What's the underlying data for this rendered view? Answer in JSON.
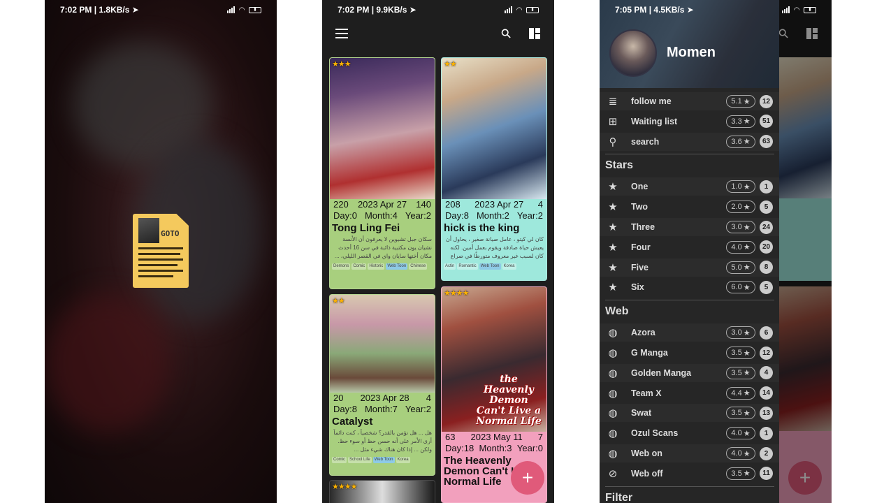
{
  "screens": [
    {
      "status": {
        "time": "7:02 PM",
        "speed": "1.8KB/s"
      },
      "goto_label": "GOTO"
    },
    {
      "status": {
        "time": "7:02 PM",
        "speed": "9.9KB/s"
      },
      "cards": [
        {
          "stars": "★★★",
          "cover_text": "",
          "row1": [
            "220",
            "2023 Apr 27",
            "140"
          ],
          "row2": [
            "Day:0",
            "Month:4",
            "Year:2"
          ],
          "title": "Tong Ling Fei",
          "desc": "سكان جبل تشيوين لا يعرفون أن الأنسة نشيان يون مكتبية ذائبة في سن 16 أحدث مكان أختها سايان واي في القصر الليلي، ...",
          "tags": [
            "Demons",
            "Comic",
            "Historic",
            "Web Toon",
            "Chinese"
          ],
          "color": "#a8cf7e"
        },
        {
          "stars": "★★",
          "cover_text": "",
          "row1": [
            "208",
            "2023 Apr 27",
            "4"
          ],
          "row2": [
            "Day:8",
            "Month:2",
            "Year:2"
          ],
          "title": "hick is the king",
          "desc": "كان لي كيتو ، عامل صيانة صغير ، يحاول أن يعيش حياة صادقة ويقوم بعمل أمين. لكنه كان لسبب غير معروف متورطًا في صراع ...",
          "tags": [
            "Actin",
            "Romantic",
            "Web Toon",
            "Korea"
          ],
          "color": "#9ee8dc"
        },
        {
          "stars": "★★",
          "cover_text": "",
          "row1": [
            "20",
            "2023 Apr 28",
            "4"
          ],
          "row2": [
            "Day:8",
            "Month:7",
            "Year:2"
          ],
          "title": "Catalyst",
          "desc": "هل ... هل نؤمن بالقدر؟ شخصياً ، كنت دائماً أرى الأمر على أنه حسن حظ أو سوء حظ. ولكن ... إذا كان هناك شيء مثل ...",
          "tags": [
            "Comic",
            "School Life",
            "Web Toon",
            "Korea"
          ],
          "color": "#a8cf7e"
        },
        {
          "stars": "★★★★",
          "cover_text": "the Heavenly Demon Can't Live a Normal Life",
          "row1": [
            "63",
            "2023 May 11",
            "7"
          ],
          "row2": [
            "Day:18",
            "Month:3",
            "Year:0"
          ],
          "title": "The Heavenly Demon Can't Live A Normal Life",
          "desc": "",
          "tags": [],
          "color": "#f2a0bd"
        },
        {
          "stars": "★★★★",
          "cover_text": "",
          "row1": [],
          "row2": [],
          "title": "",
          "desc": "",
          "tags": [],
          "color": "#2a2a2a"
        }
      ],
      "fab": "+"
    },
    {
      "status": {
        "time": "7:05 PM",
        "speed": "4.5KB/s"
      },
      "user": "Momen",
      "main_items": [
        {
          "icon": "list-icon",
          "glyph": "≣",
          "label": "follow me",
          "rate": "5.1",
          "count": "12"
        },
        {
          "icon": "add-box-icon",
          "glyph": "⊞",
          "label": "Waiting list",
          "rate": "3.3",
          "count": "51"
        },
        {
          "icon": "search-icon",
          "glyph": "⚲",
          "label": "search",
          "rate": "3.6",
          "count": "63"
        }
      ],
      "stars_header": "Stars",
      "stars_items": [
        {
          "label": "One",
          "rate": "1.0",
          "count": "1"
        },
        {
          "label": "Two",
          "rate": "2.0",
          "count": "5"
        },
        {
          "label": "Three",
          "rate": "3.0",
          "count": "24"
        },
        {
          "label": "Four",
          "rate": "4.0",
          "count": "20"
        },
        {
          "label": "Five",
          "rate": "5.0",
          "count": "8"
        },
        {
          "label": "Six",
          "rate": "6.0",
          "count": "5"
        }
      ],
      "web_header": "Web",
      "web_items": [
        {
          "label": "Azora",
          "rate": "3.0",
          "count": "6"
        },
        {
          "label": "G Manga",
          "rate": "3.5",
          "count": "12"
        },
        {
          "label": "Golden Manga",
          "rate": "3.5",
          "count": "4"
        },
        {
          "label": "Team X",
          "rate": "4.4",
          "count": "14"
        },
        {
          "label": "Swat",
          "rate": "3.5",
          "count": "13"
        },
        {
          "label": "Ozul Scans",
          "rate": "4.0",
          "count": "1"
        },
        {
          "label": "Web on",
          "rate": "4.0",
          "count": "2"
        },
        {
          "label": "Web off",
          "rate": "3.5",
          "count": "11"
        }
      ],
      "filter_header": "Filter"
    }
  ]
}
